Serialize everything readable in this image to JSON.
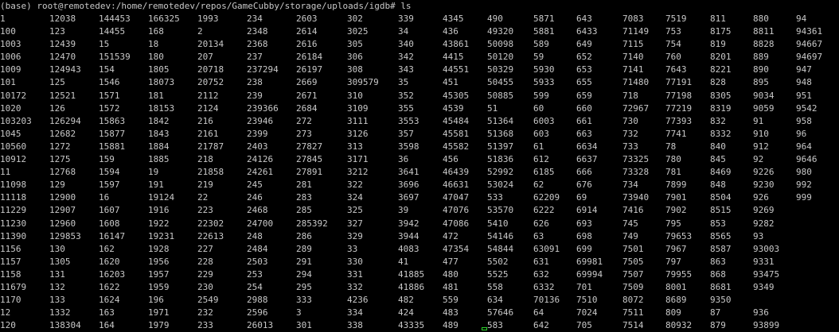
{
  "terminal": {
    "prompt": "(base) root@remotedev:/home/remotedev/repos/GameCubby/storage/uploads/igdb# ls",
    "cursor_color": "#2bd42b",
    "text_color": "#c8c8c8",
    "background_color": "#000000",
    "rows": [
      [
        "1",
        "12038",
        "144453",
        "166325",
        "1993",
        "234",
        "2603",
        "302",
        "339",
        "4345",
        "490",
        "5871",
        "643",
        "7083",
        "7519",
        "811",
        "880",
        "94"
      ],
      [
        "100",
        "123",
        "14455",
        "168",
        "2",
        "2348",
        "2614",
        "3025",
        "34",
        "436",
        "49320",
        "5881",
        "6433",
        "71149",
        "753",
        "8175",
        "8811",
        "94361"
      ],
      [
        "1003",
        "12439",
        "15",
        "18",
        "20134",
        "2368",
        "2616",
        "305",
        "340",
        "43861",
        "50098",
        "589",
        "649",
        "7115",
        "754",
        "819",
        "8828",
        "94667"
      ],
      [
        "1006",
        "12470",
        "151539",
        "180",
        "207",
        "237",
        "26184",
        "306",
        "342",
        "4415",
        "50120",
        "59",
        "652",
        "7140",
        "760",
        "8201",
        "889",
        "94697"
      ],
      [
        "1009",
        "124943",
        "154",
        "1805",
        "20718",
        "237294",
        "26197",
        "308",
        "343",
        "44551",
        "50329",
        "5930",
        "653",
        "7141",
        "7643",
        "8221",
        "890",
        "947"
      ],
      [
        "101",
        "125",
        "1546",
        "18073",
        "20752",
        "238",
        "2669",
        "309579",
        "35",
        "451",
        "50455",
        "5933",
        "655",
        "71480",
        "77191",
        "828",
        "895",
        "948"
      ],
      [
        "10172",
        "12521",
        "1571",
        "181",
        "2112",
        "239",
        "2671",
        "310",
        "352",
        "45305",
        "50885",
        "599",
        "659",
        "718",
        "77198",
        "8305",
        "9034",
        "951"
      ],
      [
        "1020",
        "126",
        "1572",
        "18153",
        "2124",
        "239366",
        "2684",
        "3109",
        "355",
        "4539",
        "51",
        "60",
        "660",
        "72967",
        "77219",
        "8319",
        "9059",
        "9542"
      ],
      [
        "103203",
        "126294",
        "15863",
        "1842",
        "216",
        "23946",
        "272",
        "3111",
        "3553",
        "45484",
        "51364",
        "6003",
        "661",
        "730",
        "77393",
        "832",
        "91",
        "958"
      ],
      [
        "1045",
        "12682",
        "15877",
        "1843",
        "2161",
        "2399",
        "273",
        "3126",
        "357",
        "45581",
        "51368",
        "603",
        "663",
        "732",
        "7741",
        "8332",
        "910",
        "96"
      ],
      [
        "10560",
        "1272",
        "15881",
        "1884",
        "21787",
        "2403",
        "27827",
        "313",
        "3598",
        "45582",
        "51397",
        "61",
        "6634",
        "733",
        "78",
        "840",
        "912",
        "964"
      ],
      [
        "10912",
        "1275",
        "159",
        "1885",
        "218",
        "24126",
        "27845",
        "3171",
        "36",
        "456",
        "51836",
        "612",
        "6637",
        "73325",
        "780",
        "845",
        "92",
        "9646"
      ],
      [
        "11",
        "12768",
        "1594",
        "19",
        "21858",
        "24261",
        "27891",
        "3212",
        "3641",
        "46439",
        "52992",
        "6185",
        "666",
        "73328",
        "781",
        "8469",
        "9226",
        "980"
      ],
      [
        "11098",
        "129",
        "1597",
        "191",
        "219",
        "245",
        "281",
        "322",
        "3696",
        "46631",
        "53024",
        "62",
        "676",
        "734",
        "7899",
        "848",
        "9230",
        "992"
      ],
      [
        "11118",
        "12900",
        "16",
        "19124",
        "22",
        "246",
        "283",
        "324",
        "3697",
        "47047",
        "533",
        "62209",
        "69",
        "73940",
        "7901",
        "8504",
        "926",
        "999"
      ],
      [
        "11229",
        "12907",
        "1607",
        "1916",
        "223",
        "2468",
        "285",
        "325",
        "39",
        "47076",
        "53570",
        "6222",
        "6914",
        "7416",
        "7902",
        "8515",
        "9269"
      ],
      [
        "11230",
        "12960",
        "1608",
        "1922",
        "22302",
        "24700",
        "285392",
        "327",
        "3942",
        "47086",
        "5410",
        "626",
        "693",
        "745",
        "795",
        "853",
        "9282"
      ],
      [
        "11390",
        "129853",
        "16147",
        "19231",
        "22613",
        "248",
        "286",
        "329",
        "3944",
        "472",
        "54146",
        "63",
        "698",
        "749",
        "79653",
        "8565",
        "93"
      ],
      [
        "1156",
        "130",
        "162",
        "1928",
        "227",
        "2484",
        "289",
        "33",
        "4083",
        "47354",
        "54844",
        "63091",
        "699",
        "7501",
        "7967",
        "8587",
        "93003"
      ],
      [
        "1157",
        "1305",
        "1620",
        "1956",
        "228",
        "2503",
        "291",
        "330",
        "41",
        "477",
        "5502",
        "631",
        "69981",
        "7505",
        "797",
        "863",
        "9331"
      ],
      [
        "1158",
        "131",
        "16203",
        "1957",
        "229",
        "253",
        "294",
        "331",
        "41885",
        "480",
        "5525",
        "632",
        "69994",
        "7507",
        "79955",
        "868",
        "93475"
      ],
      [
        "11679",
        "132",
        "1622",
        "1959",
        "230",
        "254",
        "295",
        "332",
        "41886",
        "481",
        "558",
        "6332",
        "701",
        "7509",
        "8001",
        "8681",
        "9349"
      ],
      [
        "1170",
        "133",
        "1624",
        "196",
        "2549",
        "2988",
        "333",
        "4236",
        "482",
        "559",
        "634",
        "70136",
        "7510",
        "8072",
        "8689",
        "9350"
      ],
      [
        "12",
        "1332",
        "163",
        "1971",
        "232",
        "2596",
        "3",
        "334",
        "424",
        "483",
        "57646",
        "64",
        "7024",
        "7511",
        "809",
        "87",
        "936"
      ],
      [
        "120",
        "138304",
        "164",
        "1979",
        "233",
        "26013",
        "301",
        "338",
        "43335",
        "489",
        "583",
        "642",
        "705",
        "7514",
        "80932",
        "879",
        "93899"
      ]
    ]
  }
}
